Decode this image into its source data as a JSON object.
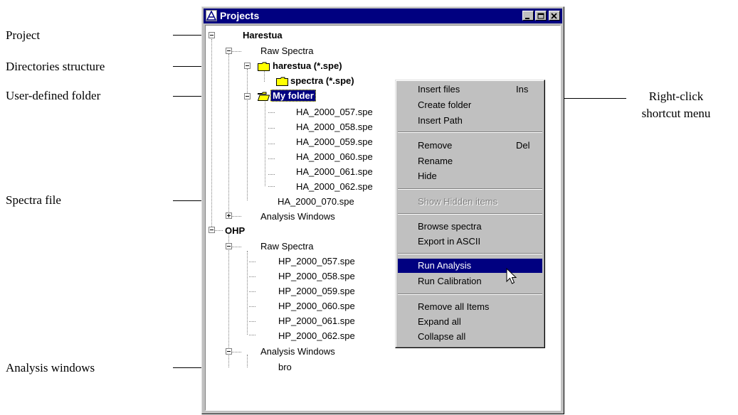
{
  "annotations": {
    "project": "Project",
    "directories": "Directories structure",
    "user_folder": "User-defined folder",
    "spectra_file": "Spectra file",
    "analysis_windows": "Analysis windows",
    "right_click_line1": "Right-click",
    "right_click_line2": "shortcut menu"
  },
  "window": {
    "title": "Projects",
    "buttons": [
      "minimize",
      "maximize",
      "close"
    ]
  },
  "tree": {
    "project1": {
      "name": "Harestua",
      "raw_spectra": "Raw Spectra",
      "dir_folder": "harestua (*.spe)",
      "sub_folder": "spectra (*.spe)",
      "user_folder": "My folder",
      "folder_files": [
        "HA_2000_057.spe",
        "HA_2000_058.spe",
        "HA_2000_059.spe",
        "HA_2000_060.spe",
        "HA_2000_061.spe",
        "HA_2000_062.spe"
      ],
      "loose_file": "HA_2000_070.spe",
      "analysis_windows": "Analysis Windows"
    },
    "project2": {
      "name": "OHP",
      "raw_spectra": "Raw Spectra",
      "files": [
        "HP_2000_057.spe",
        "HP_2000_058.spe",
        "HP_2000_059.spe",
        "HP_2000_060.spe",
        "HP_2000_061.spe",
        "HP_2000_062.spe"
      ],
      "analysis_windows": "Analysis Windows",
      "window_item": "bro"
    }
  },
  "context_menu": {
    "insert_files": "Insert files",
    "insert_files_shortcut": "Ins",
    "create_folder": "Create folder",
    "insert_path": "Insert Path",
    "remove": "Remove",
    "remove_shortcut": "Del",
    "rename": "Rename",
    "hide": "Hide",
    "show_hidden": "Show Hidden items",
    "browse_spectra": "Browse spectra",
    "export_ascii": "Export in ASCII",
    "run_analysis": "Run Analysis",
    "run_calibration": "Run Calibration",
    "remove_all": "Remove all Items",
    "expand_all": "Expand all",
    "collapse_all": "Collapse all"
  },
  "colors": {
    "title_bar": "#000080",
    "highlight": "#000080",
    "folder": "#ffff00",
    "face": "#c0c0c0"
  }
}
